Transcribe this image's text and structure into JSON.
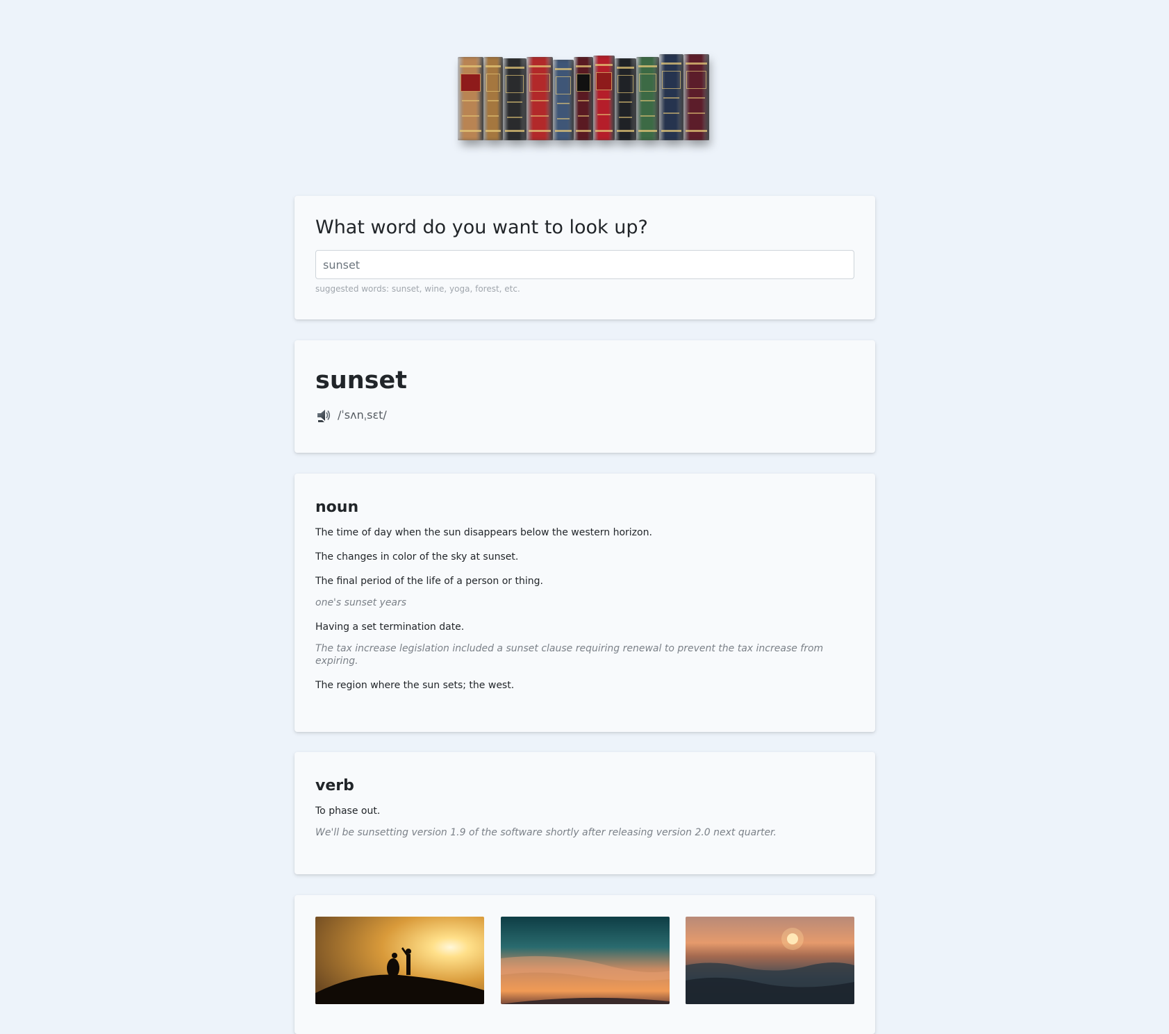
{
  "header": {
    "image_alt": "row of law dictionaries",
    "book_colors": [
      "#b98453",
      "#a5773f",
      "#2a2b2d",
      "#b2292a",
      "#3f5677",
      "#5a1a22",
      "#b51e2a",
      "#1f2226",
      "#3c6a45",
      "#26344f",
      "#5c1d2a"
    ]
  },
  "search": {
    "title": "What word do you want to look up?",
    "value": "sunset",
    "hint": "suggested words: sunset, wine, yoga, forest, etc."
  },
  "word": {
    "title": "sunset",
    "phonetic": "/ˈsʌnˌsɛt/",
    "speaker_icon": "speaker-icon"
  },
  "meanings": [
    {
      "part_of_speech": "noun",
      "definitions": [
        {
          "text": "The time of day when the sun disappears below the western horizon.",
          "example": ""
        },
        {
          "text": "The changes in color of the sky at sunset.",
          "example": ""
        },
        {
          "text": "The final period of the life of a person or thing.",
          "example": "one's sunset years"
        },
        {
          "text": "Having a set termination date.",
          "example": "The tax increase legislation included a sunset clause requiring renewal to prevent the tax increase from expiring."
        },
        {
          "text": "The region where the sun sets; the west.",
          "example": ""
        }
      ]
    },
    {
      "part_of_speech": "verb",
      "definitions": [
        {
          "text": "To phase out.",
          "example": "We'll be sunsetting version 1.9 of the software shortly after releasing version 2.0 next quarter."
        }
      ]
    }
  ],
  "photos": [
    {
      "name": "couple silhouette at sunset",
      "icon": "photo"
    },
    {
      "name": "teal and orange sunset sky",
      "icon": "photo"
    },
    {
      "name": "ocean waves at sunset",
      "icon": "photo"
    }
  ]
}
